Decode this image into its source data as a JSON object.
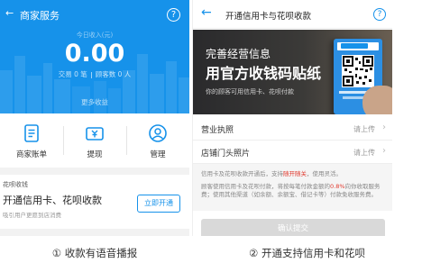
{
  "left": {
    "back": "←",
    "title": "商家服务",
    "help_icon": "?",
    "today_label": "今日收入(元)",
    "amount": "0.00",
    "stat_count": "交易 0 笔",
    "stat_visitors": "顾客数 0 人",
    "more_label": "更多收益",
    "grid": [
      {
        "icon": "document-icon",
        "label": "商家账单"
      },
      {
        "icon": "withdraw-icon",
        "label": "提现"
      },
      {
        "icon": "person-icon",
        "label": "管理"
      }
    ],
    "card": {
      "tag": "花呗收钱",
      "title": "开通信用卡、花呗收款",
      "subtitle": "吸引用户更愿到店消费",
      "button": "立即开通"
    }
  },
  "right": {
    "back": "←",
    "title": "开通信用卡与花呗收款",
    "help_icon": "?",
    "banner": {
      "line1": "完善经营信息",
      "line2": "用官方收钱码贴纸",
      "line3": "你的顾客可用信用卡、花呗付款"
    },
    "rows": [
      {
        "label": "营业执照",
        "action": "请上传",
        "chevron": "›"
      },
      {
        "label": "店铺门头照片",
        "action": "请上传",
        "chevron": "›"
      }
    ],
    "notice_1a": "信用卡及花呗收款开通后，支持",
    "notice_1b": "随开随关",
    "notice_1c": "，使用灵活。",
    "notice_2a": "顾客使用信用卡及花呗付款，将按每笔付款金额的",
    "notice_2b": "0.8%",
    "notice_2c": "向你收取服务费；使用其他渠道（如余额、余额宝、借记卡等）付款免收服务费。",
    "apply_button": "确认提交"
  },
  "captions": {
    "left": "① 收款有语音播报",
    "right": "② 开通支持信用卡和花呗"
  },
  "colors": {
    "brand_blue": "#1692ea",
    "highlight_red": "#e03a2f"
  }
}
